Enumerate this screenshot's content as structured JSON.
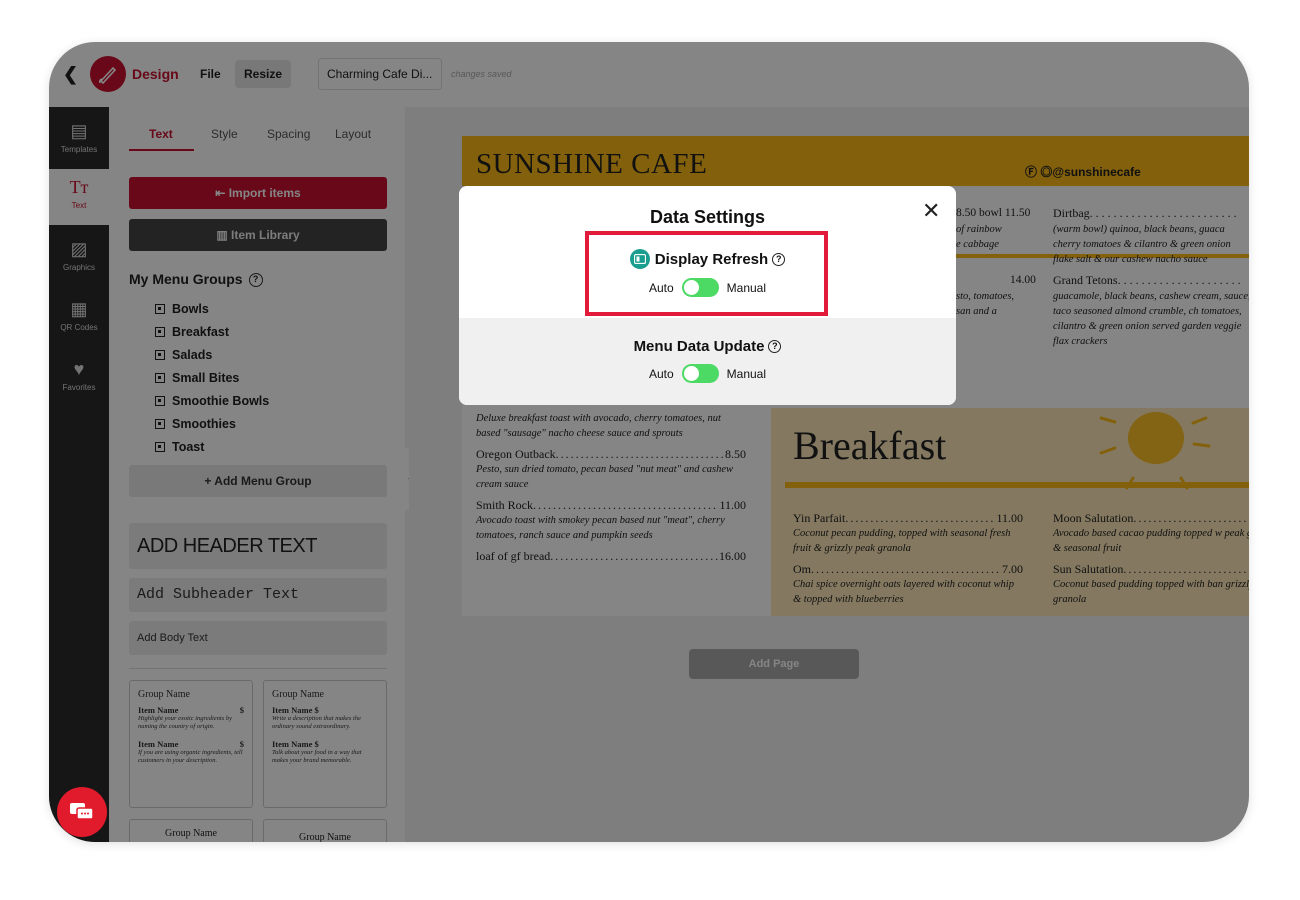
{
  "topbar": {
    "app_name": "Design",
    "file_label": "File",
    "resize_label": "Resize",
    "document_name": "Charming Cafe Di...",
    "save_status": "changes saved"
  },
  "rail": {
    "items": [
      {
        "label": "Templates",
        "icon": "templates-icon"
      },
      {
        "label": "Text",
        "icon": "text-icon",
        "active": true
      },
      {
        "label": "Graphics",
        "icon": "image-icon"
      },
      {
        "label": "QR Codes",
        "icon": "qr-code-icon"
      },
      {
        "label": "Favorites",
        "icon": "heart-icon"
      }
    ]
  },
  "panel": {
    "tabs": [
      "Text",
      "Style",
      "Spacing",
      "Layout"
    ],
    "active_tab": "Text",
    "import_label": "Import items",
    "library_label": "Item Library",
    "groups_title": "My Menu Groups",
    "groups": [
      "Bowls",
      "Breakfast",
      "Salads",
      "Small Bites",
      "Smoothie Bowls",
      "Smoothies",
      "Toast"
    ],
    "add_group_label": "+ Add Menu Group",
    "header_text": "ADD HEADER TEXT",
    "subheader_text": "Add Subheader Text",
    "body_text": "Add Body Text",
    "template1": {
      "group": "Group Name",
      "item1_name": "Item Name",
      "item1_price": "$",
      "item1_desc": "Highlight your exotic ingredients by naming the country of origin.",
      "item2_name": "Item Name",
      "item2_price": "$",
      "item2_desc": "If you are using organic ingredients, tell customers in your description."
    },
    "template2": {
      "group": "Group Name",
      "item1_name": "Item Name $",
      "item1_desc": "Write a description that makes the ordinary sound extraordinary.",
      "item2_name": "Item Name $",
      "item2_desc": "Talk about your food in a way that makes your brand memorable."
    },
    "template3_group": "Group Name",
    "template4_group": "Group Name"
  },
  "menu": {
    "title": "SUNSHINE CAFE",
    "social": "@sunshinecafe",
    "left_items": [
      {
        "name": "",
        "price": "",
        "desc": "Deluxe breakfast toast with avocado, cherry tomatoes, nut based \"sausage\" nacho cheese sauce and sprouts"
      },
      {
        "name": "Oregon Outback",
        "price": "8.50",
        "desc": "Pesto, sun dried tomato, pecan based \"nut meat\" and cashew cream sauce"
      },
      {
        "name": "Smith Rock",
        "price": "11.00",
        "desc": "Avocado toast with smokey pecan based nut \"meat\", cherry tomatoes, ranch sauce and pumpkin seeds"
      },
      {
        "name": "loaf of gf bread",
        "price": "16.00",
        "desc": ""
      }
    ],
    "partial_mid": {
      "price_line": "8.50  bowl 11.50",
      "line1": "of rainbow",
      "line2": "e cabbage",
      "price2": "14.00",
      "line3": "sto, tomatoes,",
      "line4": "san and a"
    },
    "partial_right": {
      "name1": "Dirtbag",
      "desc1": "(warm bowl) quinoa, black beans, guaca cherry tomatoes & cilantro & green onion flake salt & our cashew nacho sauce",
      "name2": "Grand Tetons",
      "desc2": "guacamole, black beans, cashew cream, sauce, taco seasoned almond crumble, ch tomatoes, cilantro & green onion served garden veggie flax crackers"
    },
    "breakfast_title": "Breakfast",
    "breakfast_left": [
      {
        "name": "Yin Parfait",
        "price": "11.00",
        "desc": "Coconut pecan pudding, topped with seasonal fresh fruit & grizzly peak granola"
      },
      {
        "name": "Om",
        "price": "7.00",
        "desc": "Chai spice overnight oats layered with coconut whip & topped with blueberries"
      }
    ],
    "breakfast_right": [
      {
        "name": "Moon Salutation",
        "price": "",
        "desc": "Avocado based cacao pudding topped w peak granola & seasonal fruit"
      },
      {
        "name": "Sun Salutation",
        "price": "",
        "desc": "Coconut based pudding topped with ban grizzly peak granola"
      }
    ],
    "add_page_label": "Add Page"
  },
  "modal": {
    "title": "Data Settings",
    "section1": {
      "title": "Display Refresh",
      "left": "Auto",
      "right": "Manual",
      "state": "on"
    },
    "section2": {
      "title": "Menu Data Update",
      "left": "Auto",
      "right": "Manual",
      "state": "on"
    }
  },
  "colors": {
    "brand_red": "#c8102e",
    "highlight_red": "#e31b3b",
    "toggle_green": "#4cd964",
    "menu_yellow": "#fbb917"
  }
}
